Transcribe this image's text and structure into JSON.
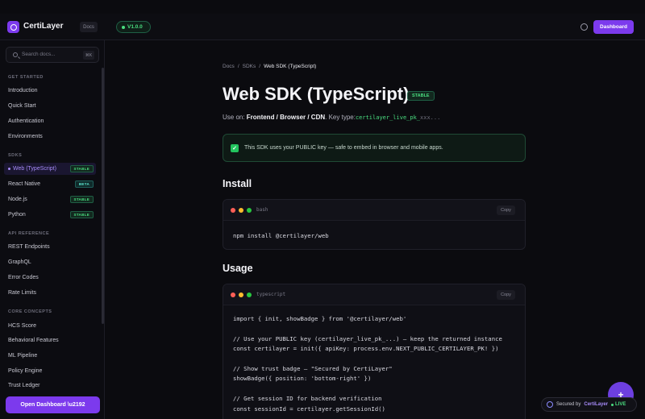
{
  "topbar": {
    "brand": "CertiLayer",
    "docs_tag": "Docs",
    "version": "V1.0.0",
    "dashboard_label": "Dashboard"
  },
  "sidebar": {
    "search_placeholder": "Search docs...",
    "search_kbd": "⌘K",
    "sections": [
      {
        "title": "GET STARTED",
        "items": [
          {
            "label": "Introduction"
          },
          {
            "label": "Quick Start"
          },
          {
            "label": "Authentication"
          },
          {
            "label": "Environments"
          }
        ]
      },
      {
        "title": "SDKS",
        "items": [
          {
            "label": "Web (TypeScript)",
            "badge": "STABLE"
          },
          {
            "label": "React Native",
            "badge": "BETA"
          },
          {
            "label": "Node.js",
            "badge": "STABLE"
          },
          {
            "label": "Python",
            "badge": "STABLE"
          }
        ]
      },
      {
        "title": "API REFERENCE",
        "items": [
          {
            "label": "REST Endpoints"
          },
          {
            "label": "GraphQL"
          },
          {
            "label": "Error Codes"
          },
          {
            "label": "Rate Limits"
          }
        ]
      },
      {
        "title": "CORE CONCEPTS",
        "items": [
          {
            "label": "HCS Score"
          },
          {
            "label": "Behavioral Features"
          },
          {
            "label": "ML Pipeline"
          },
          {
            "label": "Policy Engine"
          },
          {
            "label": "Trust Ledger"
          }
        ]
      }
    ],
    "open_dashboard": "Open Dashboard \\u2192"
  },
  "main": {
    "breadcrumb": [
      "Docs",
      "/",
      "SDKs",
      "/",
      "Web SDK (TypeScript)"
    ],
    "title": "Web SDK (TypeScript)",
    "title_badge": "STABLE",
    "use_on_prefix": "Use on: ",
    "use_on_value": "Frontend / Browser / CDN",
    "key_type_prefix": ". Key type:",
    "key_value": "certilayer_live_pk_",
    "key_suffix": "xxx...",
    "notice_icon": "✓",
    "notice": "This SDK uses your PUBLIC key — safe to embed in browser and mobile apps.",
    "install_heading": "Install",
    "install_lang": "bash",
    "copy_label": "Copy",
    "install_code": [
      "npm install @certilayer/web"
    ],
    "usage_heading": "Usage",
    "usage_lang": "typescript",
    "usage_code": [
      "import { init, showBadge } from '@certilayer/web'",
      "",
      "// Use your PUBLIC key (certilayer_live_pk_...) — keep the returned instance",
      "const certilayer = init({ apiKey: process.env.NEXT_PUBLIC_CERTILAYER_PK! })",
      "",
      "// Show trust badge — \"Secured by CertiLayer\"",
      "showBadge({ position: 'bottom-right' })",
      "",
      "// Get session ID for backend verification",
      "const sessionId = certilayer.getSessionId()"
    ]
  },
  "floating": {
    "secured_prefix": "Secured by",
    "secured_brand": "CertiLayer",
    "live": "LIVE"
  },
  "colors": {
    "accent": "#7c3aed",
    "success": "#4ade80",
    "dot_red": "#ff5f57",
    "dot_yellow": "#febc2e",
    "dot_green": "#28c840"
  }
}
